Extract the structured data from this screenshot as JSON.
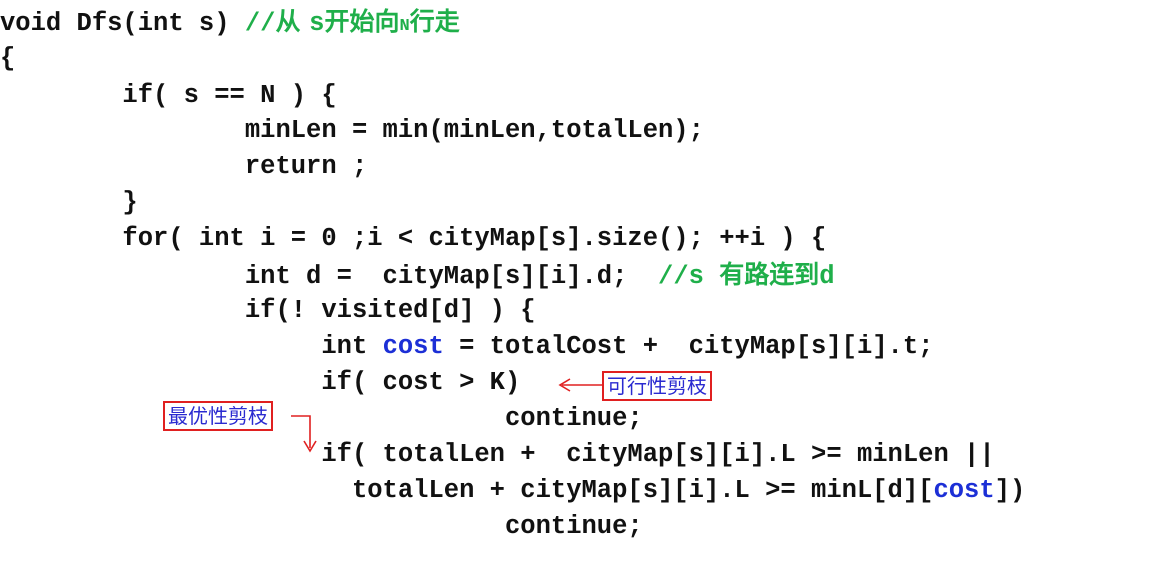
{
  "code": {
    "l1": {
      "code": "void Dfs(int s) ",
      "comment_slashes": "//",
      "comment_a": "从 ",
      "comment_b": "s",
      "comment_c": "开始向",
      "comment_d": "N",
      "comment_e": "行走"
    },
    "l2": "{",
    "l3": "        if( s == N ) {",
    "l4": "                minLen = min(minLen,totalLen);",
    "l5": "                return ;",
    "l6": "        }",
    "l7": "        for( int i = 0 ;i < cityMap[s].size(); ++i ) {",
    "l8": {
      "code": "                int d =  cityMap[s][i].d;  ",
      "comment_slashes": "//s ",
      "comment_cjk": "有路连到",
      "comment_tail": "d"
    },
    "l9": "                if(! visited[d] ) {",
    "l10": {
      "pre": "                     int ",
      "blue": "cost",
      "post": " = totalCost +  cityMap[s][i].t;"
    },
    "l11": "                     if( cost > K)",
    "l12": "                                 continue;",
    "l13": "                     if( totalLen +  cityMap[s][i].L >= minLen ||",
    "l14": {
      "pre": "                       totalLen + cityMap[s][i].L >= minL[d][",
      "blue": "cost",
      "post": "])"
    },
    "l15": "                                 continue;"
  },
  "annotations": {
    "feasibility": "可行性剪枝",
    "optimality": "最优性剪枝"
  },
  "colors": {
    "comment": "#1faf4a",
    "keyword_blue": "#1c2fd6",
    "annotation_border": "#e02020",
    "annotation_text": "#2a2ad0"
  }
}
